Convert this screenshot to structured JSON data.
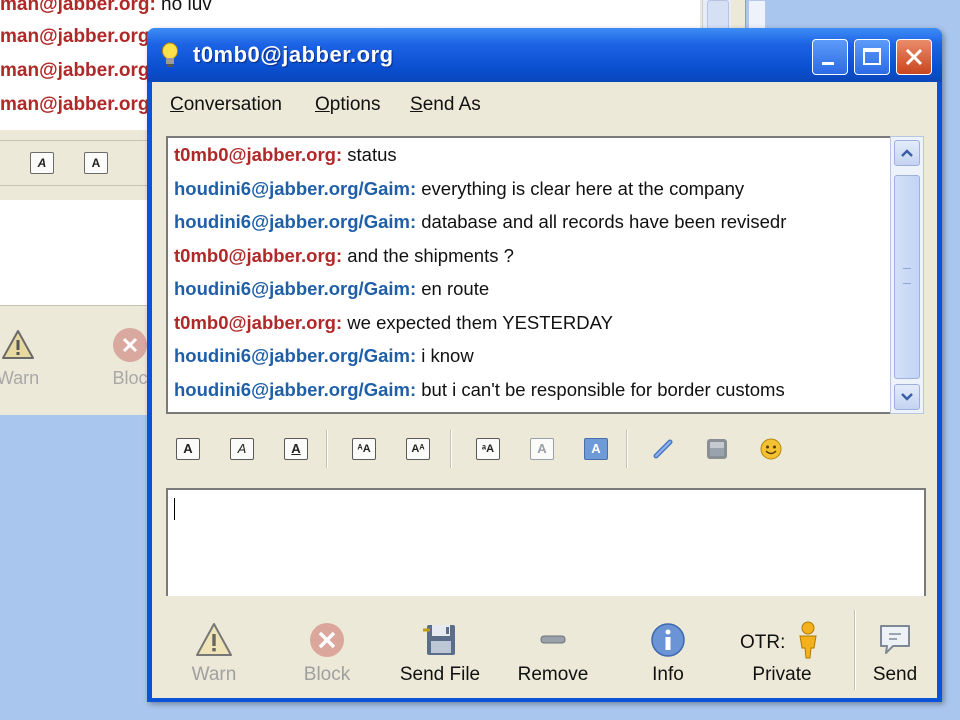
{
  "background_window": {
    "log": [
      {
        "who": "man@jabber.org:",
        "msg": " no luv"
      },
      {
        "who": "man@jabber.org",
        "msg": ""
      },
      {
        "who": "man@jabber.org",
        "msg": ""
      },
      {
        "who": "man@jabber.org",
        "msg": ""
      }
    ],
    "actions": {
      "warn": "Warn",
      "block": "Bloc"
    }
  },
  "window": {
    "title": "t0mb0@jabber.org",
    "menu": [
      "Conversation",
      "Options",
      "Send As"
    ],
    "menu_mnemonics": [
      "C",
      "O",
      "S"
    ]
  },
  "conversation": [
    {
      "who": "t0mb0@jabber.org:",
      "side": "me",
      "msg": "status"
    },
    {
      "who": "houdini6@jabber.org/Gaim:",
      "side": "them",
      "msg": "everything is clear here at the company"
    },
    {
      "who": "houdini6@jabber.org/Gaim:",
      "side": "them",
      "msg": "database and all records have been revisedr"
    },
    {
      "who": "t0mb0@jabber.org:",
      "side": "me",
      "msg": "and the shipments ?"
    },
    {
      "who": "houdini6@jabber.org/Gaim:",
      "side": "them",
      "msg": "en route"
    },
    {
      "who": "t0mb0@jabber.org:",
      "side": "me",
      "msg": "we expected them YESTERDAY"
    },
    {
      "who": "houdini6@jabber.org/Gaim:",
      "side": "them",
      "msg": "i know"
    },
    {
      "who": "houdini6@jabber.org/Gaim:",
      "side": "them",
      "msg": "but i can't be responsible for border customs"
    }
  ],
  "format_toolbar": {
    "icons": [
      "bold-icon",
      "italic-icon",
      "underline-icon",
      "font-larger-icon",
      "font-smaller-icon",
      "font-face-icon",
      "foreground-color-icon",
      "background-color-icon",
      "link-icon",
      "image-icon",
      "smiley-icon"
    ]
  },
  "input": {
    "value": ""
  },
  "actions": {
    "warn": "Warn",
    "block": "Block",
    "send_file": "Send File",
    "remove": "Remove",
    "info": "Info",
    "otr_prefix": "OTR:",
    "otr_state": "Private",
    "send": "Send"
  },
  "colors": {
    "me": "#b02828",
    "them": "#1f5fa8",
    "titlebar": "#0a52d6"
  }
}
